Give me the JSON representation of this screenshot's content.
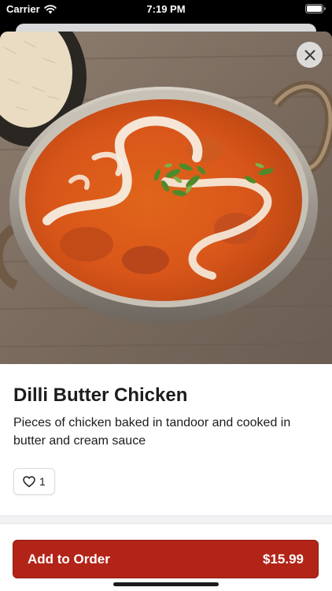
{
  "status_bar": {
    "carrier": "Carrier",
    "time": "7:19 PM",
    "icons": [
      "wifi-icon",
      "battery-icon"
    ]
  },
  "item": {
    "image_icon": "butter-chicken-photo",
    "close_icon": "close-icon",
    "title": "Dilli Butter Chicken",
    "description": "Pieces of chicken baked in tandoor and cooked in butter and cream sauce",
    "like_icon": "heart-outline-icon",
    "like_count": "1"
  },
  "order": {
    "button_label": "Add to Order",
    "price": "$15.99"
  },
  "colors": {
    "accent": "#b32418",
    "text": "#1c1c1e",
    "background": "#ffffff"
  }
}
